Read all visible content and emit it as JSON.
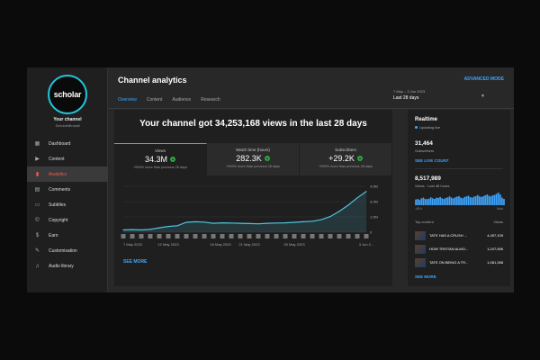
{
  "channel": {
    "logo_text": "scholar",
    "your_channel_label": "Your channel",
    "name": "ScholarMinstall"
  },
  "sidebar": {
    "items": [
      {
        "label": "Dashboard",
        "icon": "dashboard-icon",
        "active": false
      },
      {
        "label": "Content",
        "icon": "content-icon",
        "active": false
      },
      {
        "label": "Analytics",
        "icon": "analytics-icon",
        "active": true
      },
      {
        "label": "Comments",
        "icon": "comments-icon",
        "active": false
      },
      {
        "label": "Subtitles",
        "icon": "subtitles-icon",
        "active": false
      },
      {
        "label": "Copyright",
        "icon": "copyright-icon",
        "active": false
      },
      {
        "label": "Earn",
        "icon": "earn-icon",
        "active": false
      },
      {
        "label": "Customisation",
        "icon": "customisation-icon",
        "active": false
      },
      {
        "label": "Audio library",
        "icon": "audio-library-icon",
        "active": false
      }
    ]
  },
  "header": {
    "title": "Channel analytics",
    "advanced_mode": "ADVANCED MODE",
    "tabs": [
      {
        "label": "Overview",
        "active": true
      },
      {
        "label": "Content",
        "active": false
      },
      {
        "label": "Audience",
        "active": false
      },
      {
        "label": "Research",
        "active": false
      }
    ],
    "date_range": "7 May – 3 Jun 2023",
    "date_label": "Last 28 days"
  },
  "overview": {
    "headline": "Your channel got 34,253,168 views in the last 28 days",
    "metrics": [
      {
        "label": "Views",
        "value": "34.3M",
        "note": "+999% more than previous 28 days",
        "active": true
      },
      {
        "label": "Watch time (hours)",
        "value": "282.3K",
        "note": "+999% more than previous 28 days",
        "active": false
      },
      {
        "label": "Subscribers",
        "value": "+29.2K",
        "note": "+999% more than previous 28 days",
        "active": false
      }
    ],
    "see_more": "SEE MORE"
  },
  "chart_data": {
    "type": "area",
    "x": [
      "7 May 2023",
      "8 May",
      "9 May",
      "10 May",
      "11 May",
      "12 May 2023",
      "13 May",
      "14 May",
      "15 May",
      "16 May",
      "17 May",
      "18 May",
      "19 May",
      "20 May",
      "21 May 2023",
      "22 May",
      "23 May",
      "24 May",
      "25 May",
      "26 May 2023",
      "27 May",
      "28 May",
      "29 May",
      "30 May",
      "31 May",
      "1 Jun",
      "2 Jun",
      "3 Jun 2..."
    ],
    "tick_labels": [
      "7 May 2023",
      "12 May 2023",
      "16 May 2023",
      "21 May 2023",
      "26 May 2023",
      "3 Jun 2..."
    ],
    "values": [
      0.22,
      0.25,
      0.22,
      0.27,
      0.42,
      0.55,
      0.62,
      0.95,
      1.0,
      0.97,
      0.85,
      0.9,
      0.88,
      0.85,
      0.83,
      0.8,
      0.85,
      0.88,
      0.9,
      0.95,
      1.0,
      1.05,
      1.2,
      1.5,
      2.0,
      2.6,
      3.3,
      3.9
    ],
    "ylim": [
      0,
      4.4
    ],
    "y_ticks": [
      "4.5M",
      "3.0M",
      "1.5M",
      "0"
    ],
    "color": "#4dc3e0"
  },
  "realtime": {
    "title": "Realtime",
    "updating": "Updating live",
    "subscribers": "31,464",
    "subscribers_label": "Subscribers",
    "see_live_count": "SEE LIVE COUNT",
    "views": "8,517,989",
    "views_label": "Views · Last 48 hours",
    "bars": [
      0.45,
      0.5,
      0.42,
      0.55,
      0.6,
      0.5,
      0.48,
      0.52,
      0.62,
      0.55,
      0.5,
      0.6,
      0.58,
      0.65,
      0.55,
      0.5,
      0.58,
      0.62,
      0.7,
      0.6,
      0.55,
      0.62,
      0.68,
      0.72,
      0.6,
      0.55,
      0.65,
      0.7,
      0.75,
      0.65,
      0.6,
      0.68,
      0.72,
      0.8,
      0.7,
      0.65,
      0.72,
      0.78,
      0.85,
      0.75,
      0.7,
      0.78,
      0.82,
      0.9,
      1.0,
      0.85,
      0.6,
      0.5
    ],
    "axis_left": "-48 h",
    "axis_right": "Now",
    "top_content_label": "Top content",
    "top_views_label": "Views",
    "top_content": [
      {
        "rank": "",
        "name": "TATE HAS A CRUSH ...",
        "views": "4,457,109"
      },
      {
        "rank": "",
        "name": "HOW TRISTAN ALMO...",
        "views": "1,247,696"
      },
      {
        "rank": "",
        "name": "TATE ON BEING A TR...",
        "views": "1,081,288"
      }
    ],
    "see_more": "SEE MORE"
  }
}
